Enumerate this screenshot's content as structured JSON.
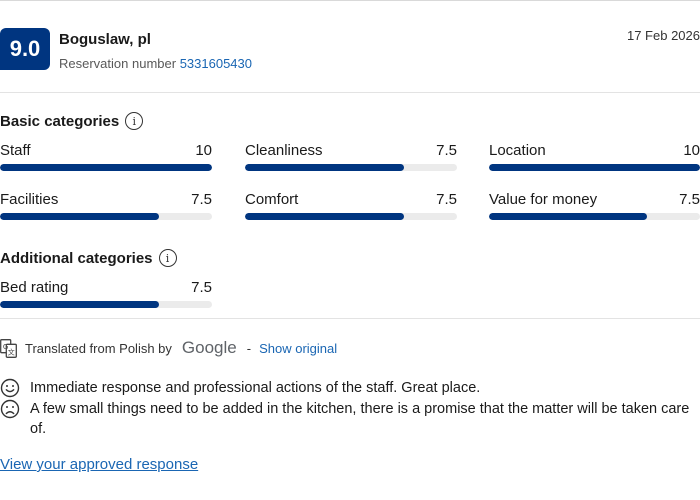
{
  "review": {
    "score": "9.0",
    "reviewer": "Boguslaw, pl",
    "reservation_label": "Reservation number",
    "reservation_number": "5331605430",
    "date": "17 Feb 2026"
  },
  "basic": {
    "title": "Basic categories",
    "items": [
      {
        "label": "Staff",
        "value": "10",
        "fraction": 1.0
      },
      {
        "label": "Cleanliness",
        "value": "7.5",
        "fraction": 0.75
      },
      {
        "label": "Location",
        "value": "10",
        "fraction": 1.0
      },
      {
        "label": "Facilities",
        "value": "7.5",
        "fraction": 0.75
      },
      {
        "label": "Comfort",
        "value": "7.5",
        "fraction": 0.75
      },
      {
        "label": "Value for money",
        "value": "7.5",
        "fraction": 0.75
      }
    ]
  },
  "additional": {
    "title": "Additional categories",
    "items": [
      {
        "label": "Bed rating",
        "value": "7.5",
        "fraction": 0.75
      }
    ]
  },
  "translation": {
    "text": "Translated from Polish by",
    "provider": "Google",
    "separator": "-",
    "show_original": "Show original"
  },
  "comments": {
    "positive": "Immediate response and professional actions of the staff. Great place.",
    "negative": "A few small things need to be added in the kitchen, there is a promise that the matter will be taken care of."
  },
  "links": {
    "approved_response": "View your approved response"
  },
  "icons": {
    "info": "info-icon",
    "translate": "translate-icon",
    "positive": "smiley-face-icon",
    "negative": "frowning-face-icon"
  },
  "colors": {
    "brand": "#003580",
    "link": "#1a66b3"
  }
}
